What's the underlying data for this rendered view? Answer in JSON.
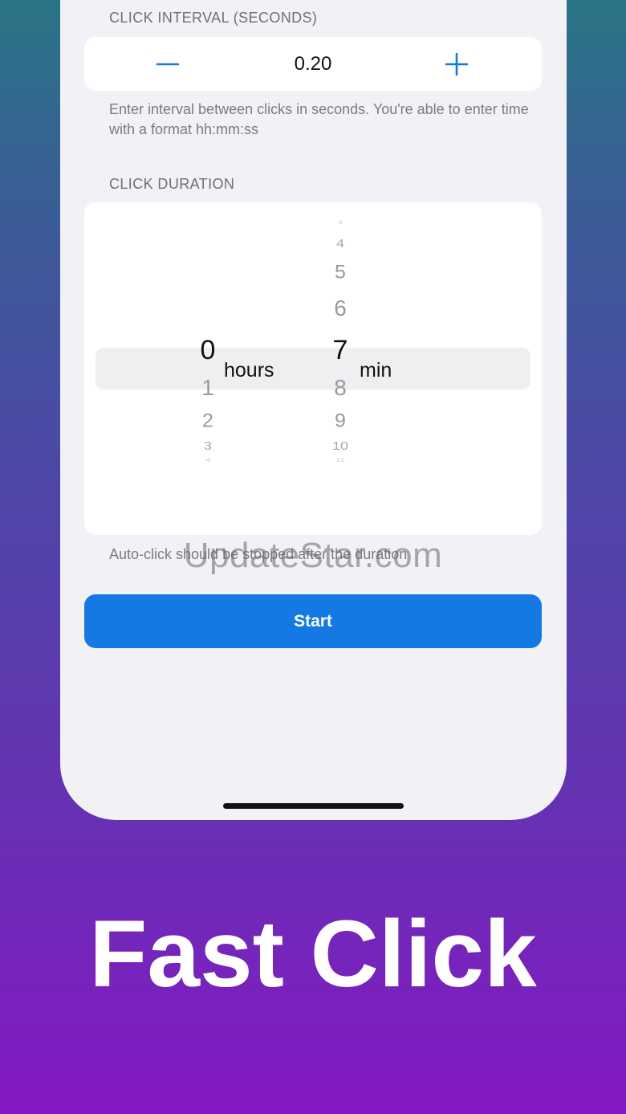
{
  "interval": {
    "label": "CLICK INTERVAL (SECONDS)",
    "value": "0.20",
    "decrement_icon": "minus-icon",
    "increment_icon": "plus-icon",
    "help": "Enter interval between clicks in seconds. You're able to enter time with a format hh:mm:ss"
  },
  "duration": {
    "label": "CLICK DURATION",
    "hours_column": [
      "0",
      "1",
      "2",
      "3",
      "4"
    ],
    "minutes_column": [
      "3",
      "4",
      "5",
      "6",
      "7",
      "8",
      "9",
      "10",
      "11"
    ],
    "selected_hours": "0",
    "selected_minutes": "7",
    "hours_unit": "hours",
    "minutes_unit": "min",
    "help": "Auto-click should be stopped after the duration"
  },
  "start_label": "Start",
  "watermark": "UpdateStar.com",
  "hero_title": "Fast Click",
  "colors": {
    "accent": "#1479e2",
    "background_top": "#2a7585",
    "background_bottom": "#8418c3"
  }
}
